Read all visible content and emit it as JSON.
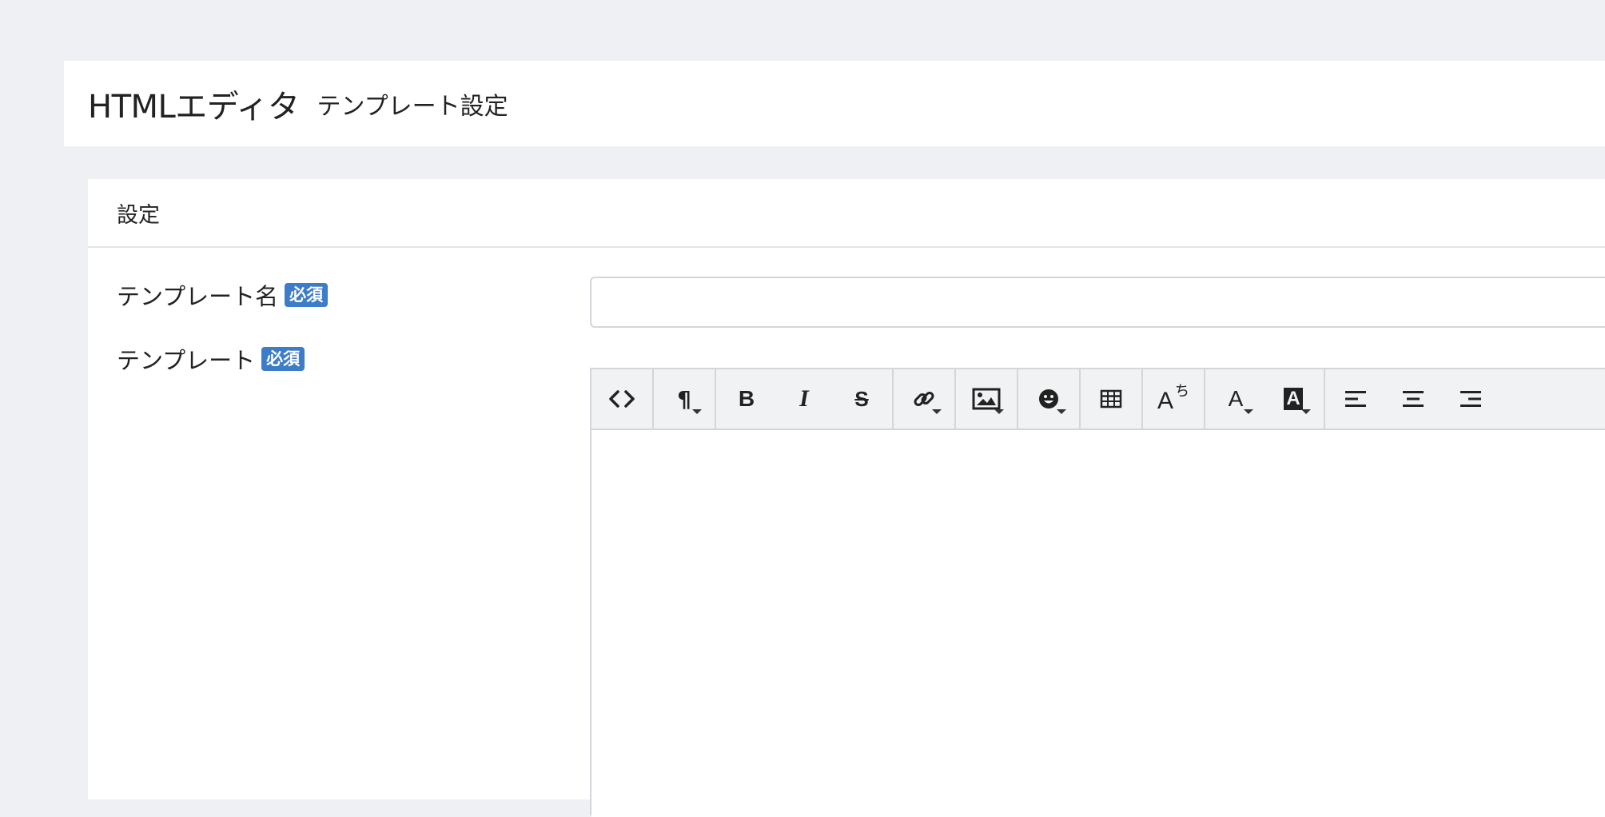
{
  "header": {
    "title": "HTMLエディタ",
    "subtitle": "テンプレート設定"
  },
  "card": {
    "title": "設定"
  },
  "form": {
    "name_label": "テンプレート名",
    "name_badge": "必須",
    "name_value": "",
    "template_label": "テンプレート",
    "template_badge": "必須"
  },
  "toolbar": {
    "paragraph_glyph": "¶",
    "bold_glyph": "B",
    "italic_glyph": "I",
    "strike_glyph": "S",
    "font_color_glyph": "A",
    "back_color_glyph": "A",
    "ruby_glyph": "A",
    "ruby_small": "ち",
    "icons": [
      "code-view-icon",
      "paragraph-icon",
      "bold-icon",
      "italic-icon",
      "strikethrough-icon",
      "link-icon",
      "image-icon",
      "emoji-icon",
      "table-icon",
      "ruby-icon",
      "font-color-icon",
      "background-color-icon",
      "align-left-icon",
      "align-center-icon",
      "align-right-icon"
    ]
  },
  "colors": {
    "page_background": "#eef0f3",
    "badge": "#3d7cc9",
    "toolbar": "#f1f2f3",
    "border": "#d3d6da"
  }
}
